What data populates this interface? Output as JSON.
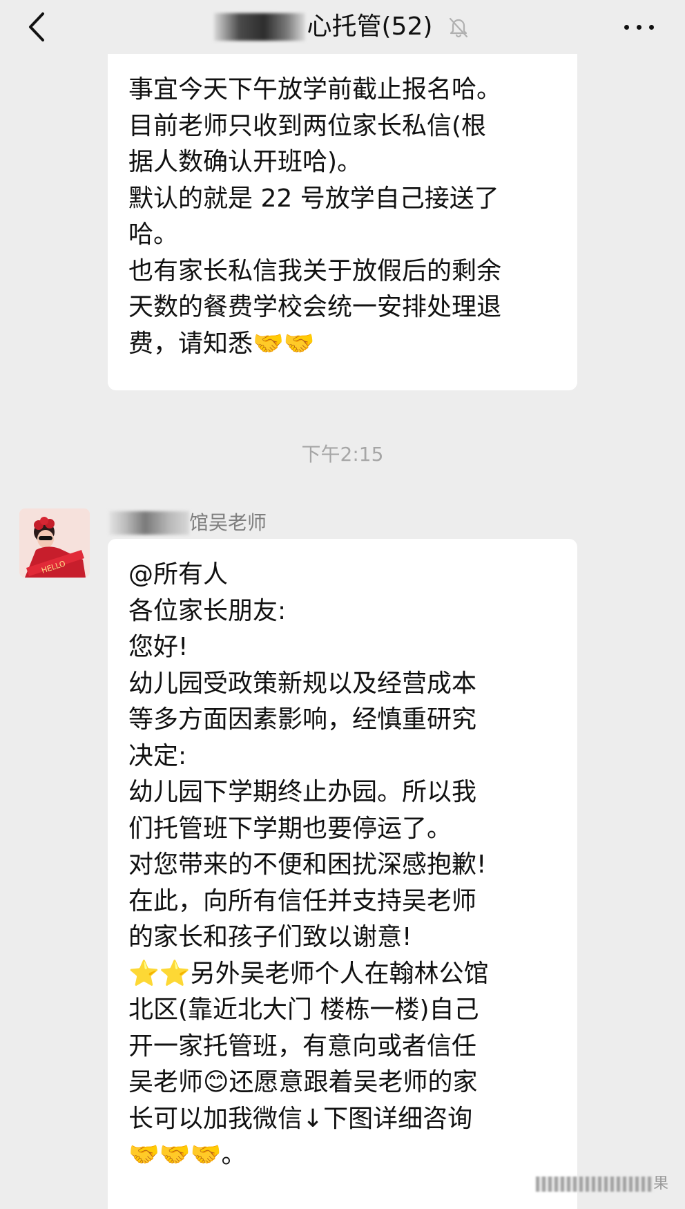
{
  "header": {
    "title": "心托管",
    "member_count": "(52)",
    "icons": {
      "back": "chevron-left-icon",
      "mute": "bell-off-icon",
      "more": "more-horizontal-icon"
    }
  },
  "messages": {
    "top": {
      "lines": [
        "事宜今天下午放学前截止报名哈。",
        "目前老师只收到两位家长私信(根",
        "据人数确认开班哈)。",
        "默认的就是 22 号放学自己接送了",
        "哈。",
        "也有家长私信我关于放假后的剩余",
        "天数的餐费学校会统一安排处理退",
        "费，请知悉🤝🤝"
      ]
    },
    "timestamp": "下午2:15",
    "main": {
      "sender": "馆吴老师",
      "lines": [
        "@所有人",
        "各位家长朋友:",
        "您好!",
        "幼儿园受政策新规以及经营成本",
        "等多方面因素影响，经慎重研究",
        "决定:",
        "幼儿园下学期终止办园。所以我",
        "们托管班下学期也要停运了。",
        "对您带来的不便和困扰深感抱歉!",
        "在此，向所有信任并支持吴老师",
        "的家长和孩子们致以谢意!",
        "⭐⭐另外吴老师个人在翰林公馆",
        "北区(靠近北大门 楼栋一楼)自己",
        "开一家托管班，有意向或者信任",
        "吴老师😊还愿意跟着吴老师的家",
        "长可以加我微信↓下图详细咨询",
        "🤝🤝🤝。"
      ]
    }
  },
  "watermark": {
    "text": "果"
  },
  "colors": {
    "background": "#ededed",
    "bubble": "#ffffff",
    "timestamp": "#a6a6a6",
    "sender": "#7f7f7f"
  }
}
